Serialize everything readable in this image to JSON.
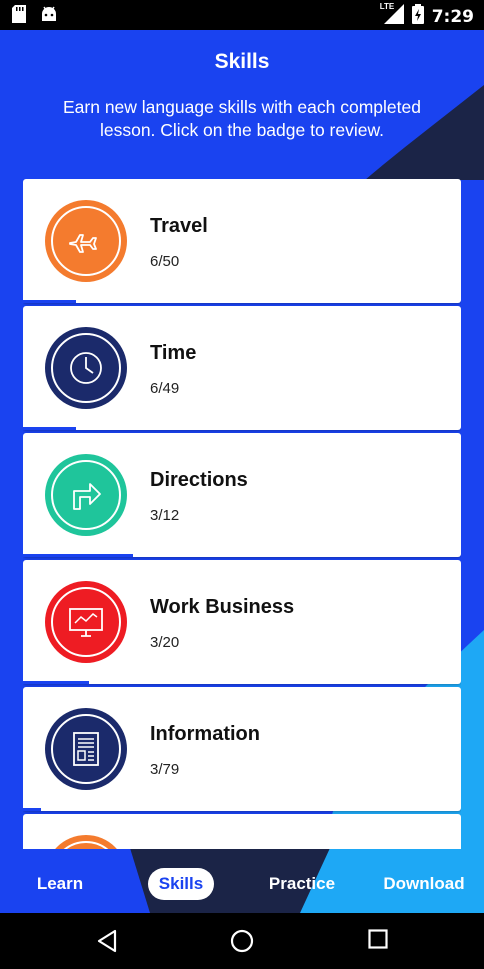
{
  "status_bar": {
    "time": "7:29",
    "network": "LTE",
    "icons": [
      "sd-card-icon",
      "android-icon",
      "signal-icon",
      "battery-icon"
    ]
  },
  "header": {
    "title": "Skills",
    "subtitle": "Earn new language skills with each completed lesson. Click on the badge to review."
  },
  "skills": [
    {
      "name": "Travel",
      "count": "6/50",
      "progress": 0.12,
      "color": "#f47b2e",
      "icon": "airplane-icon"
    },
    {
      "name": "Time",
      "count": "6/49",
      "progress": 0.12,
      "color": "#1b2a6b",
      "icon": "clock-icon"
    },
    {
      "name": "Directions",
      "count": "3/12",
      "progress": 0.25,
      "color": "#1fc59b",
      "icon": "turn-right-arrow-icon"
    },
    {
      "name": "Work Business",
      "count": "3/20",
      "progress": 0.15,
      "color": "#ee1c23",
      "icon": "monitor-chart-icon"
    },
    {
      "name": "Information",
      "count": "3/79",
      "progress": 0.04,
      "color": "#1b2a6b",
      "icon": "newspaper-icon"
    },
    {
      "name": "",
      "count": "",
      "progress": 0,
      "color": "#f47b2e",
      "icon": "partial-badge"
    }
  ],
  "tabs": [
    {
      "label": "Learn",
      "active": false
    },
    {
      "label": "Skills",
      "active": true
    },
    {
      "label": "Practice",
      "active": false
    },
    {
      "label": "Download",
      "active": false
    }
  ],
  "colors": {
    "primary_blue": "#1a43f0",
    "navy": "#1b2447",
    "light_blue": "#1ea8f5"
  }
}
